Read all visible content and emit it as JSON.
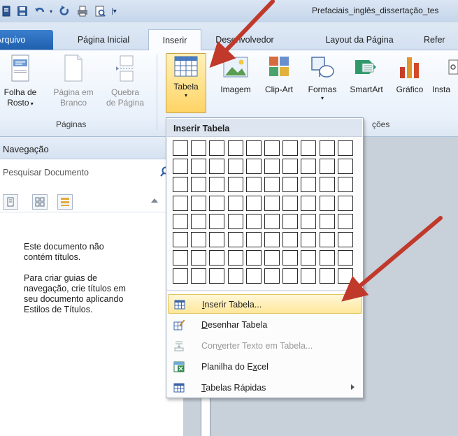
{
  "title_bar": {
    "doc_title": "Prefaciais_inglês_dissertação_tes"
  },
  "tabs": [
    {
      "id": "arquivo",
      "label": "Arquivo"
    },
    {
      "id": "pagina-inicial",
      "label": "Página Inicial"
    },
    {
      "id": "inserir",
      "label": "Inserir"
    },
    {
      "id": "desenvolvedor",
      "label": "Desenvolvedor"
    },
    {
      "id": "layout",
      "label": "Layout da Página"
    },
    {
      "id": "referencias",
      "label": "Refer"
    }
  ],
  "ribbon": {
    "paginas": {
      "group_label": "Páginas",
      "folha_de_rosto": {
        "line1": "Folha de",
        "line2": "Rosto"
      },
      "pagina_em_branco": {
        "line1": "Página em",
        "line2": "Branco"
      },
      "quebra_de_pagina": {
        "line1": "Quebra",
        "line2": "de Página"
      }
    },
    "tabela": {
      "label": "Tabela"
    },
    "imagem": {
      "label": "Imagem"
    },
    "clip_art": {
      "label": "Clip-Art"
    },
    "formas": {
      "label": "Formas"
    },
    "smartart": {
      "label": "SmartArt"
    },
    "grafico": {
      "label": "Gráfico"
    },
    "instantaneo": {
      "label": "Insta"
    },
    "ilustracoes_group_label": "ções"
  },
  "nav_pane": {
    "title": "Navegação",
    "search_placeholder": "Pesquisar Documento",
    "msg_line1": "Este documento não",
    "msg_line2": "contém títulos.",
    "msg2_line1": "Para criar guias de",
    "msg2_line2": "navegação, crie títulos em",
    "msg2_line3": "seu documento aplicando",
    "msg2_line4": "Estilos de Títulos."
  },
  "menu": {
    "header": "Inserir Tabela",
    "grid": {
      "cols": 10,
      "rows": 8
    },
    "items": [
      {
        "id": "inserir-tabela",
        "label": "Inserir Tabela...",
        "ul": "I",
        "highlighted": true,
        "disabled": false,
        "icon": "table-icon"
      },
      {
        "id": "desenhar-tabela",
        "label": "Desenhar Tabela",
        "ul": "D",
        "highlighted": false,
        "disabled": false,
        "icon": "pencil-table-icon"
      },
      {
        "id": "converter-texto",
        "label": "Converter Texto em Tabela...",
        "ul": "v",
        "highlighted": false,
        "disabled": true,
        "icon": "convert-text-icon"
      },
      {
        "id": "planilha-excel",
        "label": "Planilha do Excel",
        "ul": "x",
        "highlighted": false,
        "disabled": false,
        "icon": "excel-icon"
      },
      {
        "id": "tabelas-rapidas",
        "label": "Tabelas Rápidas",
        "ul": "T",
        "highlighted": false,
        "disabled": false,
        "icon": "quick-tables-icon",
        "submenu": true
      }
    ]
  },
  "colors": {
    "file_tab": "#2a6ebf",
    "highlight": "#ffe79a",
    "arrow": "#c0392b"
  }
}
